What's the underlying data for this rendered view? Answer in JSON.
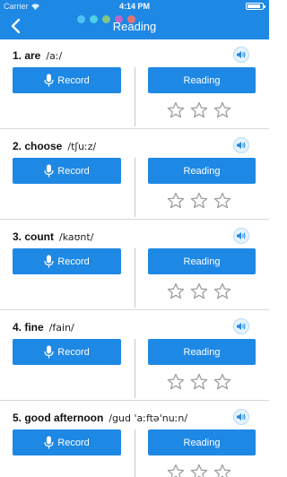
{
  "status_bar": {
    "carrier": "Carrier",
    "time": "4:14 PM",
    "battery_level": 0.9
  },
  "nav": {
    "title": "Reading",
    "back_icon": "chevron-left-icon"
  },
  "dots": [
    "#4fc3f7",
    "#4dd0e1",
    "#81c784",
    "#ba68c8",
    "#e57373"
  ],
  "colors": {
    "accent": "#1e88e5",
    "star_outline": "#9e9e9e"
  },
  "words": [
    {
      "label": "1. are",
      "phonetic": "/aː/",
      "record_label": "Record",
      "reading_label": "Reading",
      "stars_filled": 0,
      "stars_total": 3
    },
    {
      "label": "2. choose",
      "phonetic": "/tʃuːz/",
      "record_label": "Record",
      "reading_label": "Reading",
      "stars_filled": 0,
      "stars_total": 3
    },
    {
      "label": "3. count",
      "phonetic": "/kaʊnt/",
      "record_label": "Record",
      "reading_label": "Reading",
      "stars_filled": 0,
      "stars_total": 3
    },
    {
      "label": "4. fine",
      "phonetic": "/fain/",
      "record_label": "Record",
      "reading_label": "Reading",
      "stars_filled": 0,
      "stars_total": 3
    },
    {
      "label": "5. good afternoon",
      "phonetic": "/gud 'aːftə'nuːn/",
      "record_label": "Record",
      "reading_label": "Reading",
      "stars_filled": 0,
      "stars_total": 3
    }
  ]
}
